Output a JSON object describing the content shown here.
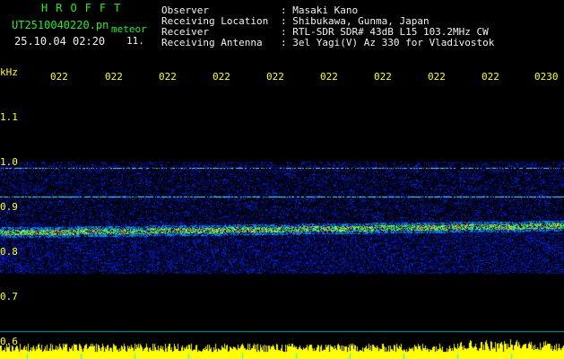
{
  "header": {
    "title": "HROFFT",
    "filename": "UT2510040220.pn",
    "mode": "meteor",
    "date_time": "25.10.04 02:20",
    "count": "11.",
    "fields": [
      {
        "label": "Observer",
        "value": ": Masaki Kano"
      },
      {
        "label": "Receiving Location",
        "value": ": Shibukawa, Gunma, Japan"
      },
      {
        "label": "Receiver",
        "value": ": RTL-SDR SDR# 43dB L15 103.2MHz CW"
      },
      {
        "label": "Receiving Antenna",
        "value": ": 3el Yagi(V) Az 330 for Vladivostok"
      }
    ]
  },
  "axis": {
    "y_unit": "kHz",
    "y_ticks": [
      "1.1",
      "1.0",
      "0.9",
      "0.8",
      "0.7",
      "0.6"
    ],
    "x_ticks": [
      "022",
      "022",
      "022",
      "022",
      "022",
      "022",
      "022",
      "022",
      "022",
      "0230"
    ]
  },
  "colors": {
    "header_text": "#2ee82e",
    "field_text": "#f2f2f2",
    "axis_text": "#ffff2a",
    "background": "#000000"
  }
}
